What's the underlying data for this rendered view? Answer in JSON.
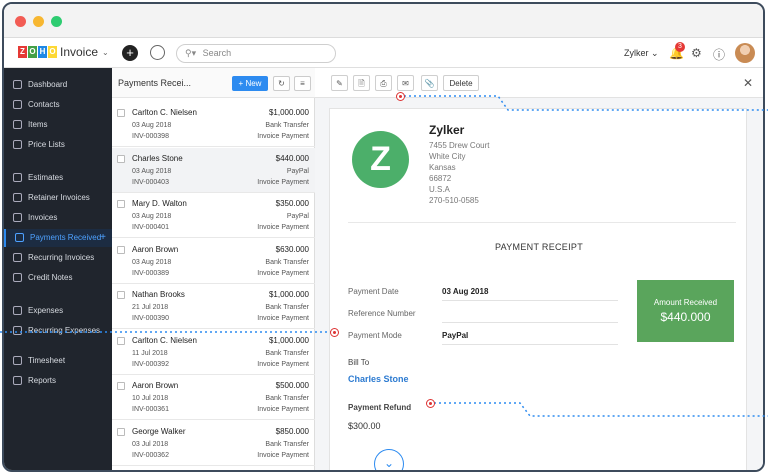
{
  "app": {
    "name": "Invoice",
    "logo_letters": [
      "Z",
      "O",
      "H",
      "O"
    ]
  },
  "topbar": {
    "search_placeholder": "Search",
    "org_name": "Zylker",
    "notification_count": "3"
  },
  "sidebar": {
    "items": [
      {
        "label": "Dashboard",
        "icon": "dashboard-icon"
      },
      {
        "label": "Contacts",
        "icon": "contacts-icon"
      },
      {
        "label": "Items",
        "icon": "items-icon"
      },
      {
        "label": "Price Lists",
        "icon": "price-list-icon"
      },
      {
        "label": "Estimates",
        "icon": "estimates-icon"
      },
      {
        "label": "Retainer Invoices",
        "icon": "retainer-icon"
      },
      {
        "label": "Invoices",
        "icon": "invoices-icon"
      },
      {
        "label": "Payments Received",
        "icon": "payments-icon",
        "active": true
      },
      {
        "label": "Recurring Invoices",
        "icon": "recurring-icon"
      },
      {
        "label": "Credit Notes",
        "icon": "credit-notes-icon"
      },
      {
        "label": "Expenses",
        "icon": "expenses-icon"
      },
      {
        "label": "Recurring Expenses",
        "icon": "recurring-expenses-icon"
      },
      {
        "label": "Timesheet",
        "icon": "timesheet-icon"
      },
      {
        "label": "Reports",
        "icon": "reports-icon"
      }
    ]
  },
  "list": {
    "title": "Payments Recei...",
    "new_label": "+ New",
    "rows": [
      {
        "name": "Carlton C. Nielsen",
        "amount": "$1,000.000",
        "date": "03 Aug 2018",
        "mode": "Bank Transfer",
        "invoice": "INV-000398",
        "type": "Invoice Payment"
      },
      {
        "name": "Charles Stone",
        "amount": "$440.000",
        "date": "03 Aug 2018",
        "mode": "PayPal",
        "invoice": "INV-000403",
        "type": "Invoice Payment"
      },
      {
        "name": "Mary D. Walton",
        "amount": "$350.000",
        "date": "03 Aug 2018",
        "mode": "PayPal",
        "invoice": "INV-000401",
        "type": "Invoice Payment"
      },
      {
        "name": "Aaron Brown",
        "amount": "$630.000",
        "date": "03 Aug 2018",
        "mode": "Bank Transfer",
        "invoice": "INV-000389",
        "type": "Invoice Payment"
      },
      {
        "name": "Nathan Brooks",
        "amount": "$1,000.000",
        "date": "21 Jul 2018",
        "mode": "Bank Transfer",
        "invoice": "INV-000390",
        "type": "Invoice Payment"
      },
      {
        "name": "Carlton C. Nielsen",
        "amount": "$1,000.000",
        "date": "11 Jul 2018",
        "mode": "Bank Transfer",
        "invoice": "INV-000392",
        "type": "Invoice Payment"
      },
      {
        "name": "Aaron Brown",
        "amount": "$500.000",
        "date": "10 Jul 2018",
        "mode": "Bank Transfer",
        "invoice": "INV-000361",
        "type": "Invoice Payment"
      },
      {
        "name": "George Walker",
        "amount": "$850.000",
        "date": "03 Jul 2018",
        "mode": "Bank Transfer",
        "invoice": "INV-000362",
        "type": "Invoice Payment"
      }
    ]
  },
  "detail": {
    "delete_label": "Delete",
    "company": "Zylker",
    "logo_letter": "Z",
    "address": [
      "7455 Drew Court",
      "White City",
      "Kansas",
      "66872",
      "U.S.A",
      "270-510-0585"
    ],
    "receipt_title": "PAYMENT RECEIPT",
    "fields": [
      {
        "label": "Payment Date",
        "value": "03 Aug 2018"
      },
      {
        "label": "Reference Number",
        "value": ""
      },
      {
        "label": "Payment Mode",
        "value": "PayPal"
      }
    ],
    "amount_label": "Amount Received",
    "amount_value": "$440.000",
    "bill_to_label": "Bill To",
    "bill_to_name": "Charles Stone",
    "refund_label": "Payment Refund",
    "refund_value": "$300.00"
  },
  "colors": {
    "accent": "#2d8bf0",
    "sidebar": "#20252d",
    "success": "#5aa55c",
    "marker": "#dd3333"
  }
}
